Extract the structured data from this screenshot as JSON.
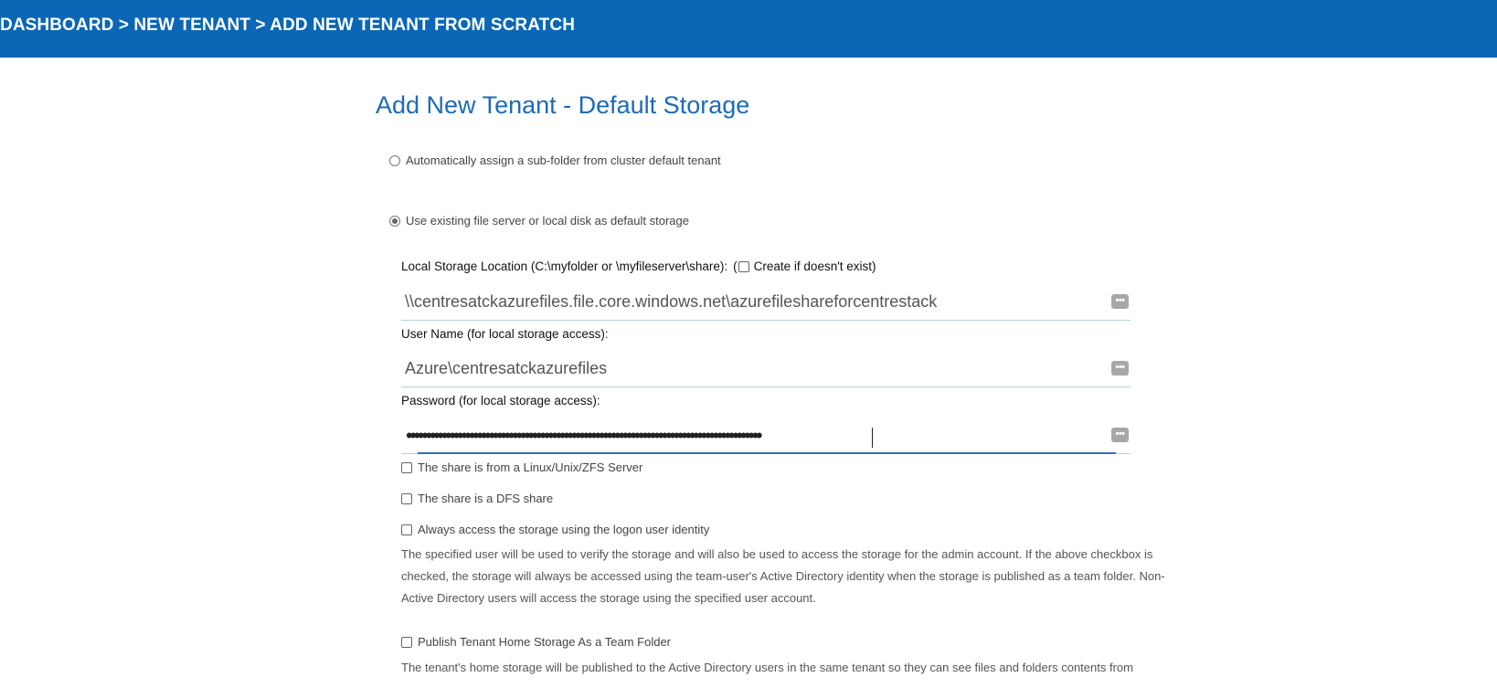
{
  "header": {
    "breadcrumb": "DASHBOARD > NEW TENANT > ADD NEW TENANT FROM SCRATCH",
    "background_color": "#0b67b5"
  },
  "page": {
    "title": "Add New Tenant - Default Storage"
  },
  "storage_options": {
    "auto_assign_label": "Automatically assign a sub-folder from cluster default tenant",
    "auto_assign_selected": false,
    "use_existing_label": "Use existing file server or local disk as default storage",
    "use_existing_selected": true
  },
  "local_storage": {
    "label": "Local Storage Location (C:\\myfolder or \\myfileserver\\share):",
    "open_paren": "(",
    "create_label": "Create if doesn't exist)",
    "create_checked": false,
    "value": "\\\\centresatckazurefiles.file.core.windows.net\\azurefileshareforcentrestack",
    "button_icon": "ellipsis-icon"
  },
  "username": {
    "label": "User Name (for local storage access):",
    "value": "Azure\\centresatckazurefiles"
  },
  "password": {
    "label": "Password (for local storage access):",
    "masked_value": "••••••••••••••••••••••••••••••••••••••••••••••••••••••••••••••••••••••••••••••••••••••••••"
  },
  "options": {
    "linux_share_label": "The share is from a Linux/Unix/ZFS Server",
    "dfs_share_label": "The share is a DFS share",
    "logon_identity_label": "Always access the storage using the logon user identity",
    "logon_identity_desc": "The specified user will be used to verify the storage and will also be used to access the storage for the admin account. If the above checkbox is checked, the storage will always be accessed using the team-user's Active Directory identity when the storage is published as a team folder. Non-Active Directory users will access the storage using the specified user account.",
    "publish_label": "Publish Tenant Home Storage As a Team Folder",
    "publish_desc": "The tenant's home storage will be published to the Active Directory users in the same tenant so they can see files and folders contents from"
  },
  "colors": {
    "title": "#1a6bb8",
    "accent": "#2f6fb8"
  }
}
